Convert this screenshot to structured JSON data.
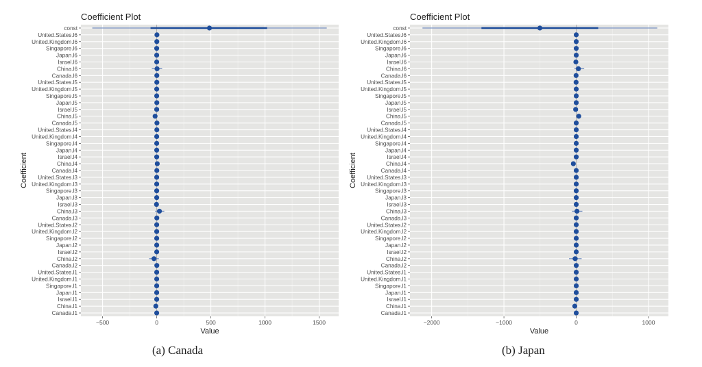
{
  "chart_data": [
    {
      "type": "coefficient-plot",
      "title": "Coefficient Plot",
      "xlabel": "Value",
      "ylabel": "Coefficient",
      "caption": "(a) Canada",
      "xlim": [
        -700,
        1680
      ],
      "xticks": [
        -500,
        0,
        500,
        1000,
        1500
      ],
      "xtick_labels": [
        "−500",
        "0",
        "500",
        "1000",
        "1500"
      ],
      "grid": true,
      "point_color": "#1f4e9c",
      "coefficients": [
        {
          "name": "const",
          "value": 487,
          "inner": [
            -57,
            1019
          ],
          "outer": [
            -595,
            1570
          ]
        },
        {
          "name": "United.States.l6",
          "value": 2,
          "inner": [
            0,
            4
          ],
          "outer": [
            -2,
            6
          ]
        },
        {
          "name": "United.Kingdom.l6",
          "value": 1,
          "inner": [
            -1,
            3
          ],
          "outer": [
            -3,
            5
          ]
        },
        {
          "name": "Singapore.l6",
          "value": 0,
          "inner": [
            -2,
            2
          ],
          "outer": [
            -4,
            4
          ]
        },
        {
          "name": "Japan.l6",
          "value": 0,
          "inner": [
            -2,
            2
          ],
          "outer": [
            -4,
            4
          ]
        },
        {
          "name": "Israel.l6",
          "value": 0,
          "inner": [
            -2,
            2
          ],
          "outer": [
            -4,
            4
          ]
        },
        {
          "name": "China.l6",
          "value": 3,
          "inner": [
            -15,
            20
          ],
          "outer": [
            -45,
            50
          ]
        },
        {
          "name": "Canada.l6",
          "value": 1,
          "inner": [
            -1,
            3
          ],
          "outer": [
            -3,
            5
          ]
        },
        {
          "name": "United.States.l5",
          "value": 1,
          "inner": [
            -1,
            3
          ],
          "outer": [
            -3,
            5
          ]
        },
        {
          "name": "United.Kingdom.l5",
          "value": 0,
          "inner": [
            -2,
            2
          ],
          "outer": [
            -4,
            4
          ]
        },
        {
          "name": "Singapore.l5",
          "value": 0,
          "inner": [
            -2,
            2
          ],
          "outer": [
            -4,
            4
          ]
        },
        {
          "name": "Japan.l5",
          "value": 1,
          "inner": [
            -1,
            3
          ],
          "outer": [
            -3,
            5
          ]
        },
        {
          "name": "Israel.l5",
          "value": 0,
          "inner": [
            -2,
            2
          ],
          "outer": [
            -4,
            4
          ]
        },
        {
          "name": "China.l5",
          "value": -15,
          "inner": [
            -25,
            -5
          ],
          "outer": [
            -35,
            5
          ]
        },
        {
          "name": "Canada.l5",
          "value": 2,
          "inner": [
            0,
            4
          ],
          "outer": [
            -2,
            6
          ]
        },
        {
          "name": "United.States.l4",
          "value": 1,
          "inner": [
            -1,
            3
          ],
          "outer": [
            -3,
            5
          ]
        },
        {
          "name": "United.Kingdom.l4",
          "value": 0,
          "inner": [
            -2,
            2
          ],
          "outer": [
            -4,
            4
          ]
        },
        {
          "name": "Singapore.l4",
          "value": 0,
          "inner": [
            -2,
            2
          ],
          "outer": [
            -4,
            4
          ]
        },
        {
          "name": "Japan.l4",
          "value": 0,
          "inner": [
            -2,
            2
          ],
          "outer": [
            -4,
            4
          ]
        },
        {
          "name": "Israel.l4",
          "value": 0,
          "inner": [
            -2,
            2
          ],
          "outer": [
            -4,
            4
          ]
        },
        {
          "name": "China.l4",
          "value": 5,
          "inner": [
            0,
            10
          ],
          "outer": [
            -5,
            15
          ]
        },
        {
          "name": "Canada.l4",
          "value": 1,
          "inner": [
            -1,
            3
          ],
          "outer": [
            -3,
            5
          ]
        },
        {
          "name": "United.States.l3",
          "value": 0,
          "inner": [
            -2,
            2
          ],
          "outer": [
            -4,
            4
          ]
        },
        {
          "name": "United.Kingdom.l3",
          "value": 0,
          "inner": [
            -2,
            2
          ],
          "outer": [
            -4,
            4
          ]
        },
        {
          "name": "Singapore.l3",
          "value": 0,
          "inner": [
            -2,
            2
          ],
          "outer": [
            -4,
            4
          ]
        },
        {
          "name": "Japan.l3",
          "value": 0,
          "inner": [
            -2,
            2
          ],
          "outer": [
            -4,
            4
          ]
        },
        {
          "name": "Israel.l3",
          "value": -2,
          "inner": [
            -4,
            0
          ],
          "outer": [
            -6,
            2
          ]
        },
        {
          "name": "China.l3",
          "value": 25,
          "inner": [
            5,
            45
          ],
          "outer": [
            -15,
            70
          ]
        },
        {
          "name": "Canada.l3",
          "value": 1,
          "inner": [
            -1,
            3
          ],
          "outer": [
            -3,
            5
          ]
        },
        {
          "name": "United.States.l2",
          "value": 0,
          "inner": [
            -2,
            2
          ],
          "outer": [
            -4,
            4
          ]
        },
        {
          "name": "United.Kingdom.l2",
          "value": 0,
          "inner": [
            -2,
            2
          ],
          "outer": [
            -4,
            4
          ]
        },
        {
          "name": "Singapore.l2",
          "value": 0,
          "inner": [
            -2,
            2
          ],
          "outer": [
            -4,
            4
          ]
        },
        {
          "name": "Japan.l2",
          "value": 0,
          "inner": [
            -2,
            2
          ],
          "outer": [
            -4,
            4
          ]
        },
        {
          "name": "Israel.l2",
          "value": 0,
          "inner": [
            -2,
            2
          ],
          "outer": [
            -4,
            4
          ]
        },
        {
          "name": "China.l2",
          "value": -25,
          "inner": [
            -45,
            -5
          ],
          "outer": [
            -70,
            20
          ]
        },
        {
          "name": "Canada.l2",
          "value": 1,
          "inner": [
            -1,
            3
          ],
          "outer": [
            -3,
            5
          ]
        },
        {
          "name": "United.States.l1",
          "value": 0,
          "inner": [
            -2,
            2
          ],
          "outer": [
            -4,
            4
          ]
        },
        {
          "name": "United.Kingdom.l1",
          "value": 0,
          "inner": [
            -2,
            2
          ],
          "outer": [
            -4,
            4
          ]
        },
        {
          "name": "Singapore.l1",
          "value": 0,
          "inner": [
            -2,
            2
          ],
          "outer": [
            -4,
            4
          ]
        },
        {
          "name": "Japan.l1",
          "value": 0,
          "inner": [
            -2,
            2
          ],
          "outer": [
            -4,
            4
          ]
        },
        {
          "name": "Israel.l1",
          "value": 0,
          "inner": [
            -2,
            2
          ],
          "outer": [
            -4,
            4
          ]
        },
        {
          "name": "China.l1",
          "value": -8,
          "inner": [
            -14,
            -2
          ],
          "outer": [
            -20,
            4
          ]
        },
        {
          "name": "Canada.l1",
          "value": 0,
          "inner": [
            -2,
            2
          ],
          "outer": [
            -4,
            4
          ]
        }
      ]
    },
    {
      "type": "coefficient-plot",
      "title": "Coefficient Plot",
      "xlabel": "Value",
      "ylabel": "Coefficient",
      "caption": "(b) Japan",
      "xlim": [
        -2300,
        1275
      ],
      "xticks": [
        -2000,
        -1000,
        0,
        1000
      ],
      "xtick_labels": [
        "−2000",
        "−1000",
        "0",
        "1000"
      ],
      "grid": true,
      "point_color": "#1f4e9c",
      "coefficients": [
        {
          "name": "const",
          "value": -503,
          "inner": [
            -1311,
            304
          ],
          "outer": [
            -2127,
            1121
          ]
        },
        {
          "name": "United.States.l6",
          "value": 0,
          "inner": [
            -3,
            3
          ],
          "outer": [
            -6,
            6
          ]
        },
        {
          "name": "United.Kingdom.l6",
          "value": 0,
          "inner": [
            -3,
            3
          ],
          "outer": [
            -6,
            6
          ]
        },
        {
          "name": "Singapore.l6",
          "value": 0,
          "inner": [
            -3,
            3
          ],
          "outer": [
            -6,
            6
          ]
        },
        {
          "name": "Japan.l6",
          "value": 0,
          "inner": [
            -3,
            3
          ],
          "outer": [
            -6,
            6
          ]
        },
        {
          "name": "Israel.l6",
          "value": -5,
          "inner": [
            -8,
            -2
          ],
          "outer": [
            -11,
            1
          ]
        },
        {
          "name": "China.l6",
          "value": 30,
          "inner": [
            5,
            55
          ],
          "outer": [
            -25,
            110
          ]
        },
        {
          "name": "Canada.l6",
          "value": -2,
          "inner": [
            -5,
            1
          ],
          "outer": [
            -8,
            4
          ]
        },
        {
          "name": "United.States.l5",
          "value": -2,
          "inner": [
            -5,
            1
          ],
          "outer": [
            -8,
            4
          ]
        },
        {
          "name": "United.Kingdom.l5",
          "value": 0,
          "inner": [
            -3,
            3
          ],
          "outer": [
            -6,
            6
          ]
        },
        {
          "name": "Singapore.l5",
          "value": 0,
          "inner": [
            -3,
            3
          ],
          "outer": [
            -6,
            6
          ]
        },
        {
          "name": "Japan.l5",
          "value": 0,
          "inner": [
            -3,
            3
          ],
          "outer": [
            -6,
            6
          ]
        },
        {
          "name": "Israel.l5",
          "value": -8,
          "inner": [
            -12,
            -4
          ],
          "outer": [
            -16,
            0
          ]
        },
        {
          "name": "China.l5",
          "value": 35,
          "inner": [
            20,
            45
          ],
          "outer": [
            5,
            55
          ]
        },
        {
          "name": "Canada.l5",
          "value": 0,
          "inner": [
            -3,
            3
          ],
          "outer": [
            -6,
            6
          ]
        },
        {
          "name": "United.States.l4",
          "value": 0,
          "inner": [
            -3,
            3
          ],
          "outer": [
            -6,
            6
          ]
        },
        {
          "name": "United.Kingdom.l4",
          "value": 0,
          "inner": [
            -3,
            3
          ],
          "outer": [
            -6,
            6
          ]
        },
        {
          "name": "Singapore.l4",
          "value": 0,
          "inner": [
            -3,
            3
          ],
          "outer": [
            -6,
            6
          ]
        },
        {
          "name": "Japan.l4",
          "value": 0,
          "inner": [
            -3,
            3
          ],
          "outer": [
            -6,
            6
          ]
        },
        {
          "name": "Israel.l4",
          "value": 0,
          "inner": [
            -3,
            3
          ],
          "outer": [
            -6,
            6
          ]
        },
        {
          "name": "China.l4",
          "value": -40,
          "inner": [
            -50,
            -25
          ],
          "outer": [
            -60,
            -10
          ]
        },
        {
          "name": "Canada.l4",
          "value": 0,
          "inner": [
            -3,
            3
          ],
          "outer": [
            -6,
            6
          ]
        },
        {
          "name": "United.States.l3",
          "value": 0,
          "inner": [
            -3,
            3
          ],
          "outer": [
            -6,
            6
          ]
        },
        {
          "name": "United.Kingdom.l3",
          "value": 0,
          "inner": [
            -3,
            3
          ],
          "outer": [
            -6,
            6
          ]
        },
        {
          "name": "Singapore.l3",
          "value": 0,
          "inner": [
            -3,
            3
          ],
          "outer": [
            -6,
            6
          ]
        },
        {
          "name": "Japan.l3",
          "value": 0,
          "inner": [
            -3,
            3
          ],
          "outer": [
            -6,
            6
          ]
        },
        {
          "name": "Israel.l3",
          "value": 0,
          "inner": [
            -3,
            3
          ],
          "outer": [
            -6,
            6
          ]
        },
        {
          "name": "China.l3",
          "value": 10,
          "inner": [
            -20,
            40
          ],
          "outer": [
            -60,
            85
          ]
        },
        {
          "name": "Canada.l3",
          "value": 0,
          "inner": [
            -3,
            3
          ],
          "outer": [
            -6,
            6
          ]
        },
        {
          "name": "United.States.l2",
          "value": 0,
          "inner": [
            -3,
            3
          ],
          "outer": [
            -6,
            6
          ]
        },
        {
          "name": "United.Kingdom.l2",
          "value": 0,
          "inner": [
            -3,
            3
          ],
          "outer": [
            -6,
            6
          ]
        },
        {
          "name": "Singapore.l2",
          "value": 0,
          "inner": [
            -3,
            3
          ],
          "outer": [
            -6,
            6
          ]
        },
        {
          "name": "Japan.l2",
          "value": 0,
          "inner": [
            -3,
            3
          ],
          "outer": [
            -6,
            6
          ]
        },
        {
          "name": "Israel.l2",
          "value": 0,
          "inner": [
            -3,
            3
          ],
          "outer": [
            -6,
            6
          ]
        },
        {
          "name": "China.l2",
          "value": -15,
          "inner": [
            -50,
            20
          ],
          "outer": [
            -100,
            75
          ]
        },
        {
          "name": "Canada.l2",
          "value": 0,
          "inner": [
            -3,
            3
          ],
          "outer": [
            -6,
            6
          ]
        },
        {
          "name": "United.States.l1",
          "value": 0,
          "inner": [
            -3,
            3
          ],
          "outer": [
            -6,
            6
          ]
        },
        {
          "name": "United.Kingdom.l1",
          "value": 0,
          "inner": [
            -3,
            3
          ],
          "outer": [
            -6,
            6
          ]
        },
        {
          "name": "Singapore.l1",
          "value": 0,
          "inner": [
            -3,
            3
          ],
          "outer": [
            -6,
            6
          ]
        },
        {
          "name": "Japan.l1",
          "value": 0,
          "inner": [
            -3,
            3
          ],
          "outer": [
            -6,
            6
          ]
        },
        {
          "name": "Israel.l1",
          "value": 0,
          "inner": [
            -3,
            3
          ],
          "outer": [
            -6,
            6
          ]
        },
        {
          "name": "China.l1",
          "value": -20,
          "inner": [
            -30,
            -10
          ],
          "outer": [
            -40,
            0
          ]
        },
        {
          "name": "Canada.l1",
          "value": 0,
          "inner": [
            -3,
            3
          ],
          "outer": [
            -6,
            6
          ]
        }
      ]
    }
  ]
}
